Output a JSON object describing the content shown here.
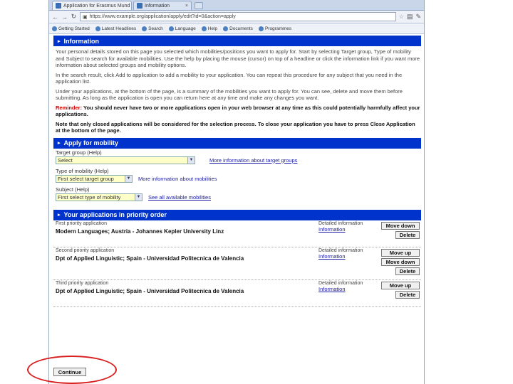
{
  "tabs": [
    {
      "label": "Application for Erasmus Mund",
      "close": "×"
    },
    {
      "label": "Information",
      "close": "×"
    }
  ],
  "address": "https://www.example.org/application/apply/edit?id=0&action=apply",
  "bookmarks": [
    "Getting Started",
    "Latest Headlines",
    "Search",
    "Language",
    "Help",
    "Documents",
    "Programmes"
  ],
  "information": {
    "header": "Information",
    "p1": "Your personal details stored on this page you selected which mobilities/positions you want to apply for. Start by selecting Target group, Type of mobility and Subject to search for available mobilities. Use the help by placing the mouse (cursor) on top of a headline or click the information link if you want more information about selected groups and mobility options.",
    "p2": "In the search result, click Add to application to add a mobility to your application. You can repeat this procedure for any subject that you need in the application list.",
    "p3": "Under your applications, at the bottom of the page, is a summary of the mobilities you want to apply for. You can see, delete and move them before submitting. As long as the application is open you can return here at any time and make any changes you want.",
    "reminder_label": "Reminder:",
    "reminder_text": "You should never have two or more applications open in your web browser at any time as this could potentially harmfully affect your applications.",
    "note": "Note that only closed applications will be considered for the selection process. To close your application you have to press Close Application at the bottom of the page."
  },
  "apply": {
    "header": "Apply for mobility",
    "target_label": "Target group (Help)",
    "target_value": "Select",
    "target_link": "More information about target groups",
    "type_label": "Type of mobility (Help)",
    "type_value": "First select target group",
    "type_link": "More information about mobilities",
    "subject_label": "Subject (Help)",
    "subject_value": "First select type of mobility",
    "subject_link": "See all available mobilities"
  },
  "applications": {
    "header": "Your applications in priority order",
    "detail_label": "Detailed information",
    "detail_link": "Information",
    "items": [
      {
        "pref": "First priority application",
        "name": "Modern Languages; Austria - Johannes Kepler University Linz"
      },
      {
        "pref": "Second priority application",
        "name": "Dpt of Applied Linguistic; Spain - Universidad Politecnica de Valencia"
      },
      {
        "pref": "Third priority application",
        "name": "Dpt of Applied Linguistic; Spain - Universidad Politecnica de Valencia"
      }
    ],
    "move_up": "Move up",
    "move_down": "Move down",
    "delete": "Delete"
  },
  "continue_label": "Continue",
  "highlight_color": "#d82020"
}
